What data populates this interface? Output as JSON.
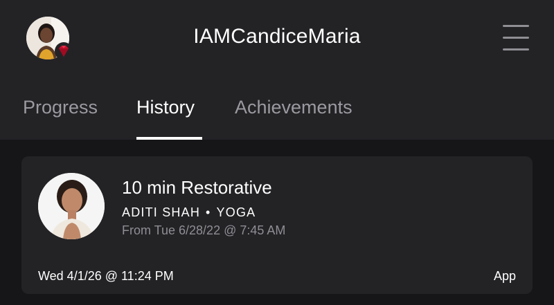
{
  "header": {
    "username": "IAMCandiceMaria",
    "badge_icon": "ruby-gem-icon",
    "menu_icon": "hamburger-menu-icon"
  },
  "tabs": [
    {
      "label": "Progress",
      "active": false
    },
    {
      "label": "History",
      "active": true
    },
    {
      "label": "Achievements",
      "active": false
    }
  ],
  "history": {
    "items": [
      {
        "title": "10 min Restorative",
        "instructor": "ADITI SHAH",
        "separator": "•",
        "category": "YOGA",
        "from": "From Tue 6/28/22 @ 7:45 AM",
        "completed_at": "Wed 4/1/26 @ 11:24 PM",
        "platform": "App"
      }
    ]
  },
  "colors": {
    "background": "#161618",
    "surface": "#232326",
    "text_primary": "#ffffff",
    "text_secondary": "#9a9aa0",
    "badge_red": "#c8102e"
  }
}
